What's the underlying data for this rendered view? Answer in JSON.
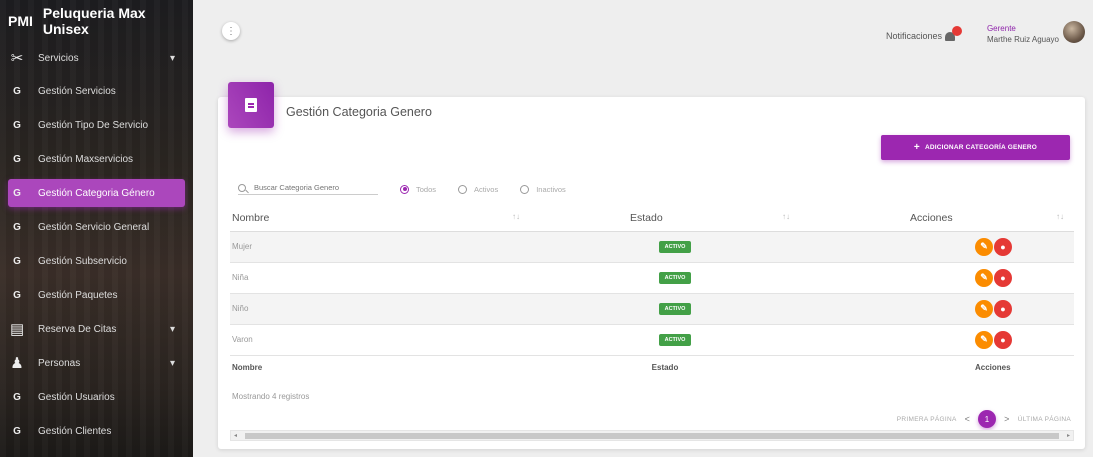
{
  "sidebar": {
    "brand_abbr": "PMI",
    "brand_name": "Peluqueria Max Unisex",
    "items": [
      {
        "icon": "G",
        "label": "Gestión Servicios"
      },
      {
        "icon": "G",
        "label": "Gestión Tipo De Servicio"
      },
      {
        "icon": "G",
        "label": "Gestión Maxservicios"
      },
      {
        "icon": "G",
        "label": "Gestión Categoria Género"
      },
      {
        "icon": "G",
        "label": "Gestión Servicio General"
      },
      {
        "icon": "G",
        "label": "Gestión Subservicio"
      },
      {
        "icon": "G",
        "label": "Gestión Paquetes"
      }
    ],
    "section_servicios": "Servicios",
    "section_reservas": "Reserva De Citas",
    "section_personas": "Personas",
    "sub_usuarios": "Gestión Usuarios",
    "sub_clientes": "Gestión Clientes",
    "sub_icon": "G"
  },
  "topbar": {
    "menu_icon": "⋮",
    "notifications_label": "Notificaciones",
    "user_role": "Gerente",
    "user_name": "Marthe Ruiz Aguayo"
  },
  "card": {
    "title": "Gestión Categoria Genero",
    "add_button": "ADICIONAR CATEGORÍA GENERO",
    "add_plus": "+",
    "search_placeholder": "Buscar Categoria Genero",
    "filter_all": "Todos",
    "filter_active": "Activos",
    "filter_inactive": "Inactivos",
    "selected_filter": "Todos"
  },
  "table": {
    "headers": [
      "Nombre",
      "Estado",
      "Acciones"
    ],
    "sort_icon": "↑↓",
    "rows": [
      {
        "nombre": "Mujer",
        "estado": "ACTIVO"
      },
      {
        "nombre": "Niña",
        "estado": "ACTIVO"
      },
      {
        "nombre": "Niño",
        "estado": "ACTIVO"
      },
      {
        "nombre": "Varon",
        "estado": "ACTIVO"
      }
    ],
    "footer": [
      "Nombre",
      "Estado",
      "Acciones"
    ]
  },
  "footer": {
    "records_info": "Mostrando 4 registros",
    "first_page": "PRIMERA PÁGINA",
    "last_page": "ÚLTIMA PÁGINA",
    "current_page": "1",
    "prev": "<",
    "next": ">"
  },
  "colors": {
    "accent": "#9c27b0",
    "active_badge": "#43a047",
    "edit": "#fb8c00",
    "delete": "#e53935"
  }
}
